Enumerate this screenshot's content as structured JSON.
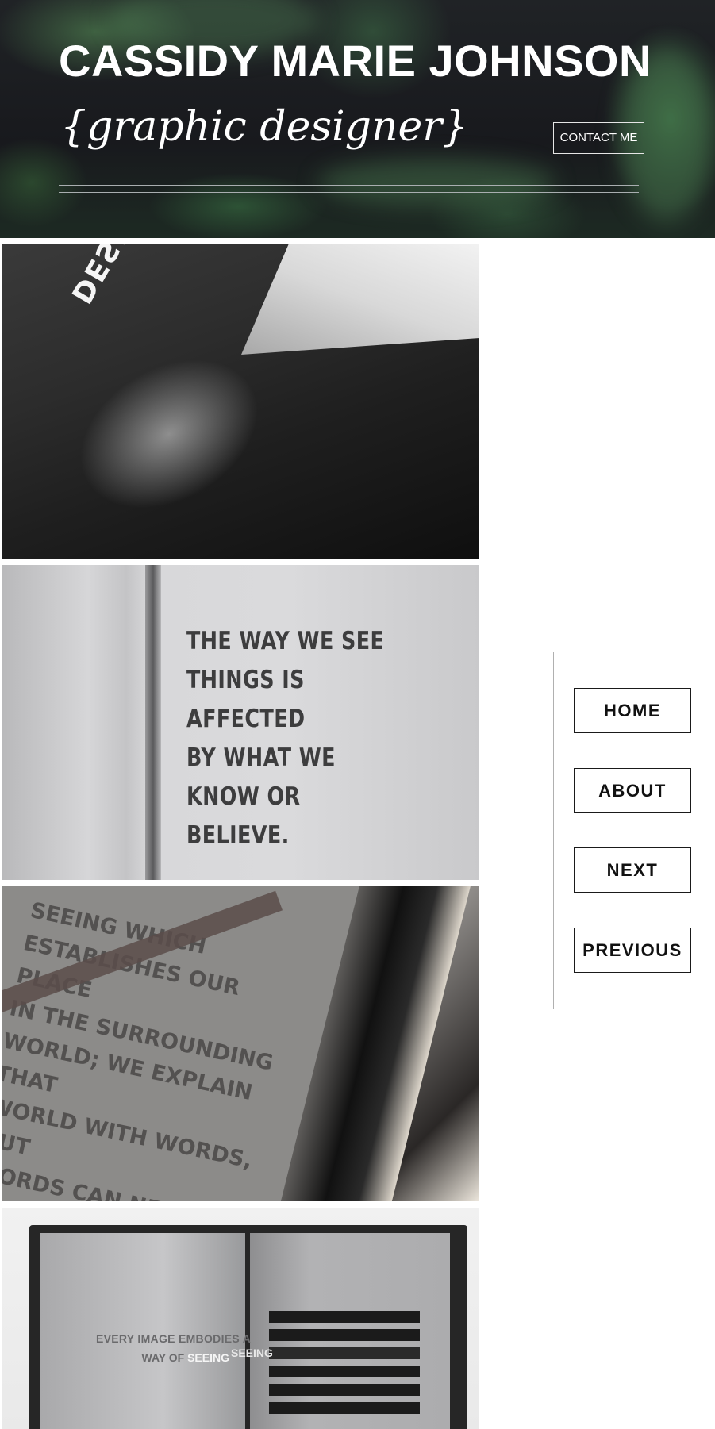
{
  "header": {
    "title": "CASSIDY MARIE JOHNSON",
    "subtitle": "{graphic designer}",
    "contact_label": "CONTACT ME"
  },
  "gallery": {
    "photo1": {
      "cover_text": "DESIGN SEEING WAYS"
    },
    "photo2": {
      "quote": "THE WAY WE SEE\nTHINGS IS AFFECTED\nBY  WHAT WE\nKNOW OR BELIEVE."
    },
    "photo3": {
      "text": "SEEING WHICH\nESTABLISHES OUR PLACE\nIN THE SURROUNDING\nWORLD; WE EXPLAIN THAT\nWORLD WITH WORDS, BUT\nWORDS CAN NEVER UNDO\nTHE FACT THAT WE ARE\nSURROUNDED BY IT."
    },
    "photo4": {
      "caption_line1": "EVERY IMAGE EMBODIES A",
      "caption_line2_prefix": "WAY OF ",
      "caption_line2_bold": "SEEING",
      "bar_label": "SEEING"
    }
  },
  "nav": {
    "items": [
      {
        "label": "HOME"
      },
      {
        "label": "ABOUT"
      },
      {
        "label": "NEXT"
      },
      {
        "label": "PREVIOUS"
      }
    ]
  },
  "colors": {
    "header_bg": "#1b1c20",
    "header_accent_green": "#5a9660",
    "page_bg": "#ffffff",
    "nav_border": "#1a1a1a"
  }
}
